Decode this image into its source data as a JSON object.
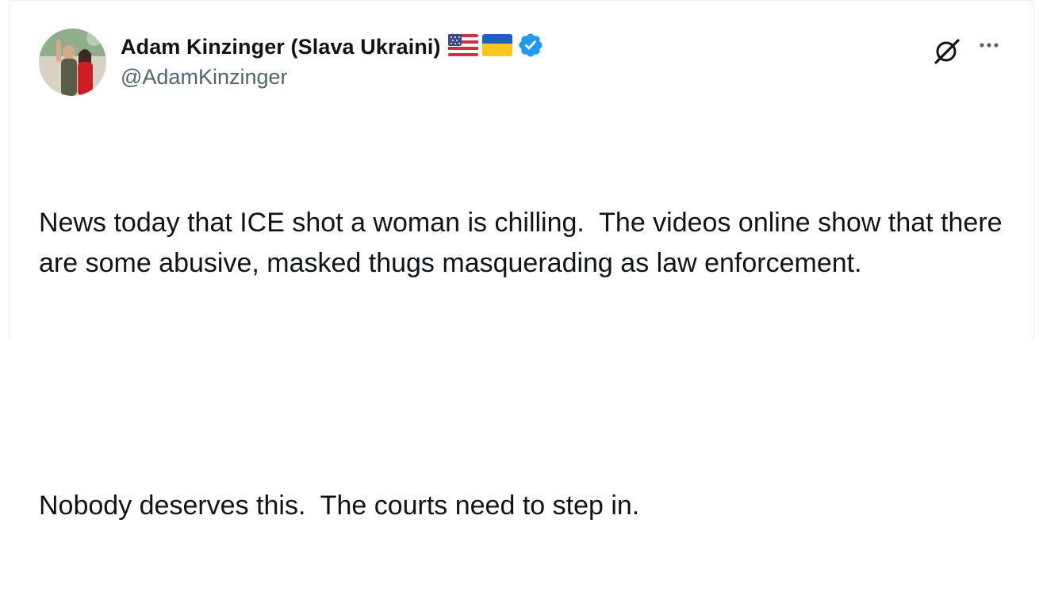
{
  "author": {
    "display_name": "Adam Kinzinger (Slava Ukraini)",
    "handle": "@AdamKinzinger",
    "avatar_icon": "profile-photo",
    "flags": [
      "us-flag-icon",
      "ukraine-flag-icon"
    ],
    "verified": true,
    "verified_color": "#1d9bf0"
  },
  "actions": {
    "grok_icon": "grok-icon",
    "more_icon": "more-icon"
  },
  "tweet": {
    "line1": "News today that ICE shot a woman is chilling.  The videos online show that there are some abusive, masked thugs masquerading as law enforcement.",
    "line2": "Nobody deserves this.  The courts need to step in."
  }
}
